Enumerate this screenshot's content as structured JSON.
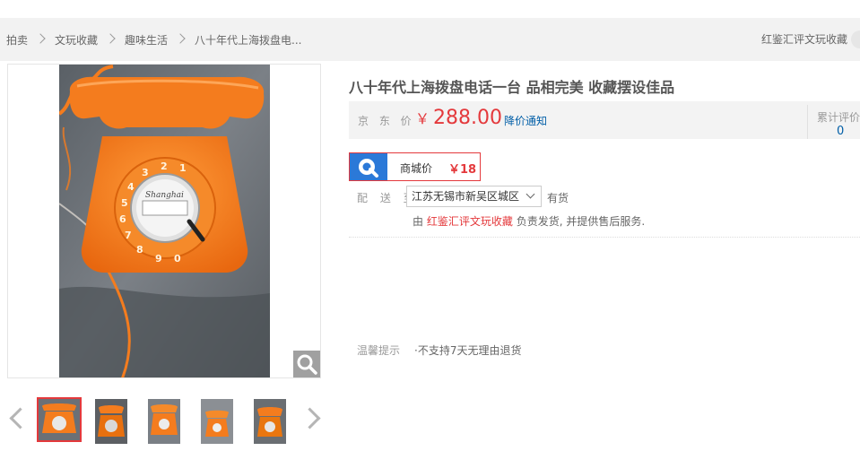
{
  "breadcrumb": {
    "items": [
      "拍卖",
      "文玩收藏",
      "趣味生活",
      "八十年代上海拨盘电..."
    ],
    "shop_name": "红鉴汇评文玩收藏"
  },
  "product": {
    "title": "八十年代上海拨盘电话一台 品相完美 收藏摆设佳品",
    "price_label": "京 东 价",
    "currency": "￥",
    "price": "288.00",
    "price_notify": "降价通知",
    "review_label": "累计评价",
    "review_count": "0",
    "mall_price_label": "商城价",
    "mall_price": "￥18",
    "shipping_label": "配 送 至",
    "region": "江苏无锡市新吴区城区",
    "stock_status": "有货",
    "seller_prefix": "由",
    "seller_name": "红鉴汇评文玩收藏",
    "seller_suffix": "负责发货, 并提供售后服务.",
    "tip_label": "温馨提示",
    "tip_text": "·不支持7天无理由退货"
  },
  "gallery": {
    "phone_brand_text": "Shanghai",
    "dial_digits": [
      "1",
      "2",
      "3",
      "4",
      "5",
      "6",
      "7",
      "8",
      "9",
      "0"
    ],
    "thumbnail_count": 5,
    "selected_index": 0
  },
  "colors": {
    "accent_red": "#e4393c",
    "link_blue": "#005ea7",
    "phone_orange": "#f47c1e",
    "mall_icon_blue": "#2b79d8"
  },
  "icons": [
    "chevron-right-icon",
    "magnifier-icon",
    "chevron-left-icon",
    "chevron-right-icon",
    "chevron-down-icon",
    "mall-logo-icon"
  ]
}
